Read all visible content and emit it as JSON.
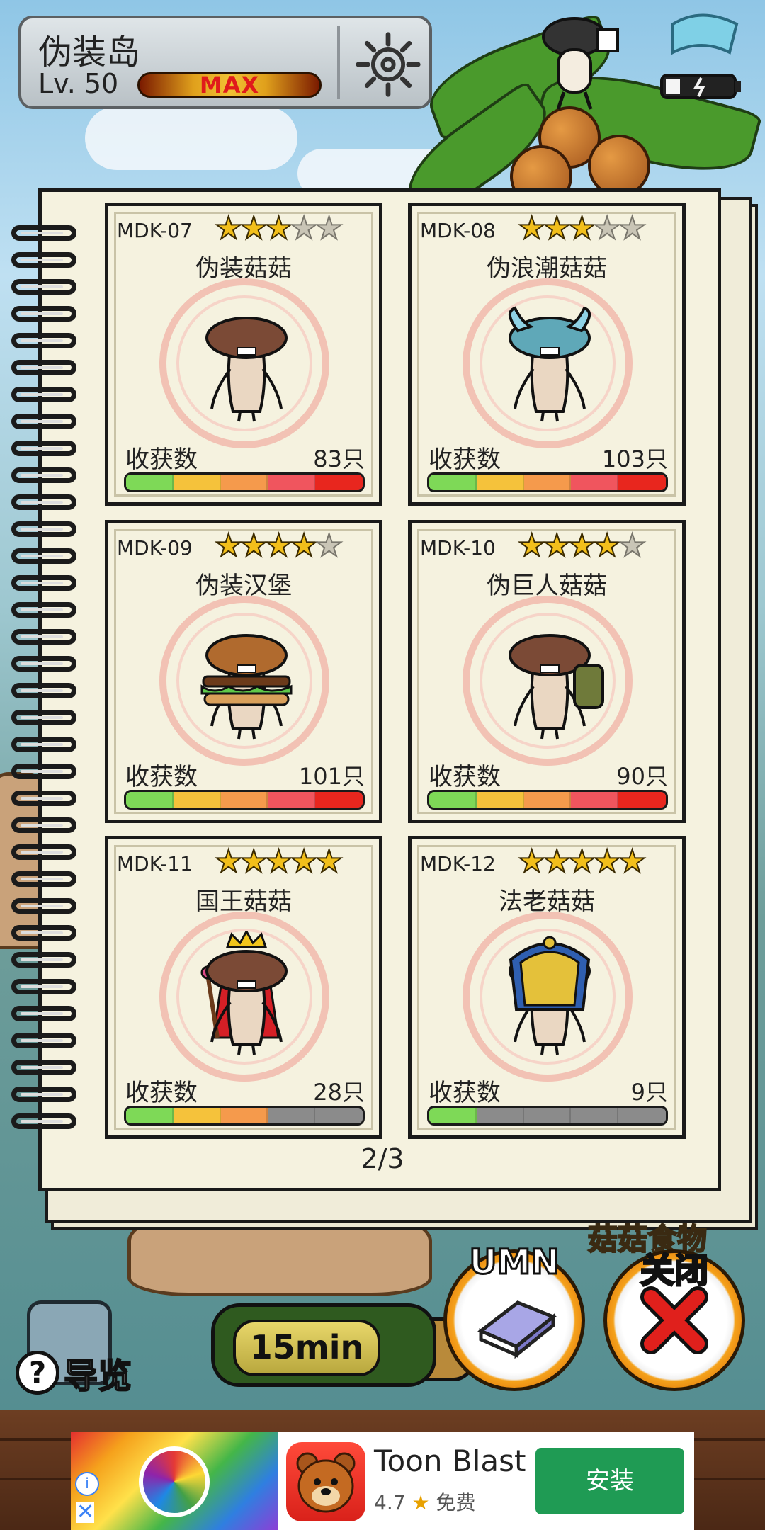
{
  "header": {
    "title": "伪装岛",
    "level": "Lv. 50",
    "max_label": "MAX",
    "settings_icon": "gear-icon"
  },
  "cards": [
    {
      "code": "MDK-07",
      "name": "伪装菇菇",
      "rating": 3,
      "max_rating": 5,
      "harvest_label": "收获数",
      "harvest_count": "83只",
      "progress_segments": 5,
      "character": "brown-mushroom"
    },
    {
      "code": "MDK-08",
      "name": "伪浪潮菇菇",
      "rating": 3,
      "max_rating": 5,
      "harvest_label": "收获数",
      "harvest_count": "103只",
      "progress_segments": 5,
      "character": "blue-wave-mushroom"
    },
    {
      "code": "MDK-09",
      "name": "伪装汉堡",
      "rating": 4,
      "max_rating": 5,
      "harvest_label": "收获数",
      "harvest_count": "101只",
      "progress_segments": 5,
      "character": "burger-mushroom"
    },
    {
      "code": "MDK-10",
      "name": "伪巨人菇菇",
      "rating": 4,
      "max_rating": 5,
      "harvest_label": "收获数",
      "harvest_count": "90只",
      "progress_segments": 5,
      "character": "giant-mushroom"
    },
    {
      "code": "MDK-11",
      "name": "国王菇菇",
      "rating": 5,
      "max_rating": 5,
      "harvest_label": "收获数",
      "harvest_count": "28只",
      "progress_segments": 3,
      "character": "king-mushroom"
    },
    {
      "code": "MDK-12",
      "name": "法老菇菇",
      "rating": 5,
      "max_rating": 5,
      "harvest_label": "收获数",
      "harvest_count": "9只",
      "progress_segments": 1,
      "character": "pharaoh-mushroom"
    }
  ],
  "pagination": {
    "label": "2/3"
  },
  "bottom": {
    "guide_label": "导览",
    "timer_label": "15min",
    "sign_label": "菇菇食物",
    "umn_label": "UMN",
    "close_label": "关闭"
  },
  "ad": {
    "title": "Toon Blast",
    "rating": "4.7",
    "price": "免费",
    "install_label": "安装"
  },
  "colors": {
    "star_on": "#f2bf1b",
    "star_off": "#c9c5b6",
    "bar_segments": [
      "#7ed957",
      "#f5c23b",
      "#f59a4c",
      "#f0555e",
      "#e8261e"
    ],
    "bar_empty": "#8b8b8b",
    "install_button": "#1f9b54"
  }
}
